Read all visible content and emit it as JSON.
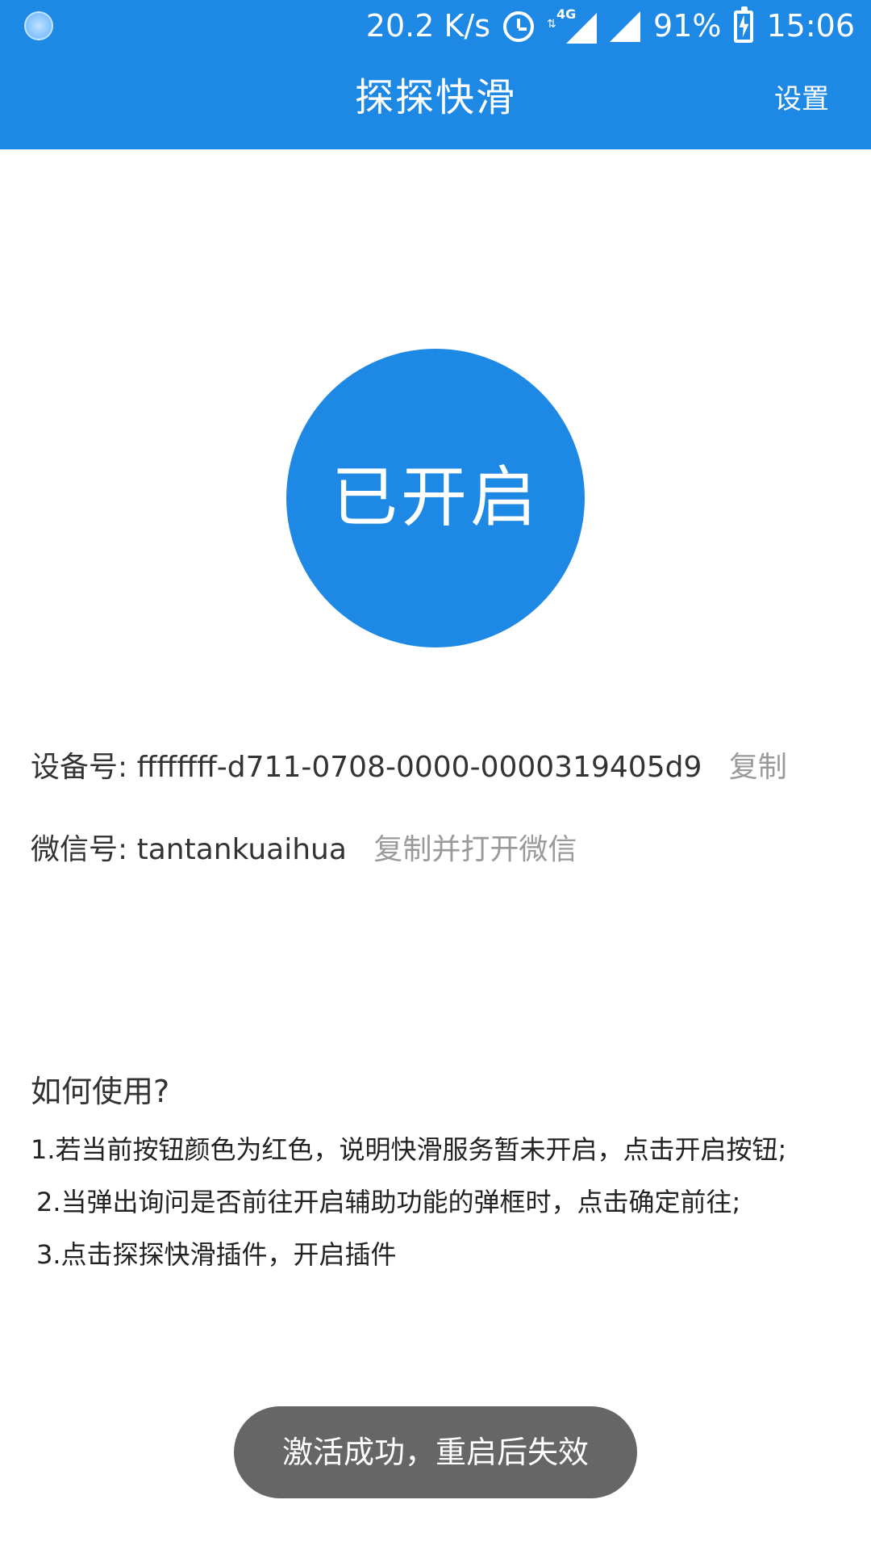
{
  "status_bar": {
    "net_speed": "20.2 K/s",
    "network_label": "4G",
    "battery": "91%",
    "time": "15:06"
  },
  "app_bar": {
    "title": "探探快滑",
    "settings_label": "设置"
  },
  "main": {
    "toggle_label": "已开启",
    "device_label": "设备号:",
    "device_id": "ffffffff-d711-0708-0000-0000319405d9",
    "device_copy_label": "复制",
    "wechat_label": "微信号:",
    "wechat_id": "tantankuaihua",
    "wechat_copy_label": "复制并打开微信"
  },
  "how_to": {
    "title": "如何使用?",
    "steps": [
      "1.若当前按钮颜色为红色，说明快滑服务暂未开启，点击开启按钮;",
      "2.当弹出询问是否前往开启辅助功能的弹框时，点击确定前往;",
      "3.点击探探快滑插件，开启插件"
    ]
  },
  "toast": {
    "message": "激活成功，重启后失效"
  },
  "colors": {
    "primary": "#1e88e5",
    "toast_bg": "#666666",
    "secondary_text": "#9a9a9a"
  },
  "icons": {
    "status_left": "loading-indicator-icon",
    "alarm": "alarm-icon",
    "signal": "signal-icon",
    "battery": "battery-charging-icon"
  }
}
